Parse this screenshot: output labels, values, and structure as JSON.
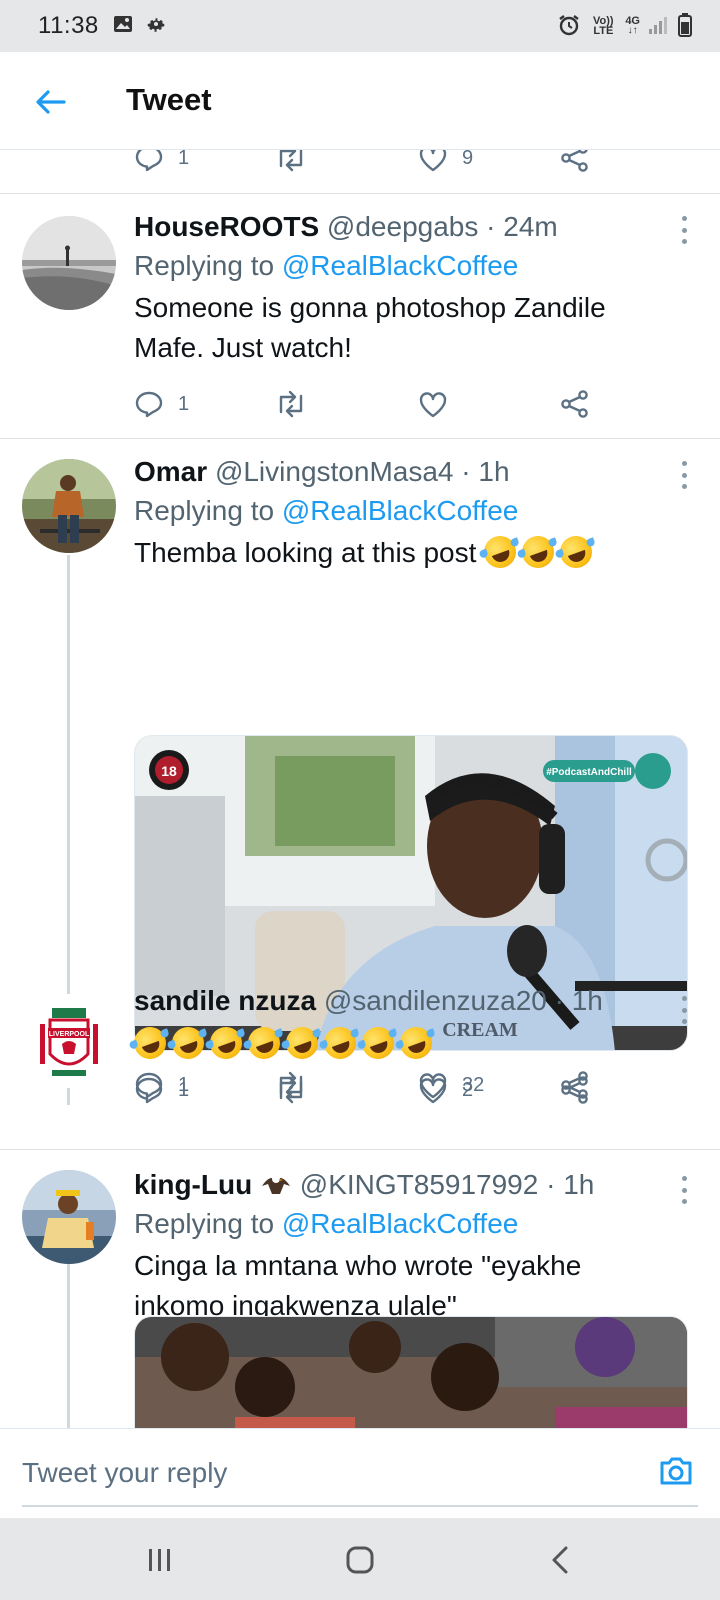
{
  "status_bar": {
    "time": "11:38",
    "network_top": "Vo)) LTE",
    "network_type": "4G",
    "icons": [
      "image-icon",
      "gear-icon",
      "alarm-icon",
      "signal-icon",
      "battery-icon"
    ]
  },
  "header": {
    "title": "Tweet"
  },
  "top_actions": {
    "replies": "1",
    "likes": "9"
  },
  "tweets": [
    {
      "name": "HouseROOTS",
      "handle": "@deepgabs",
      "time": "· 24m",
      "replying_prefix": "Replying to",
      "replying_to": "@RealBlackCoffee",
      "text_line1": "Someone is gonna photoshop Zandile",
      "text_line2": "Mafe. Just watch!",
      "replies": "1",
      "likes": ""
    },
    {
      "name": "Omar",
      "handle": "@LivingstonMasa4",
      "time": "· 1h",
      "replying_prefix": "Replying to",
      "replying_to": "@RealBlackCoffee",
      "text": "Themba looking at this post",
      "emoji_count": 3,
      "media_badge": "#PodcastAndChill",
      "media_logo": "18",
      "media_shirt": "CREAM",
      "replies": "1",
      "likes": "32"
    },
    {
      "name": "sandile nzuza",
      "handle": "@sandilenzuza20",
      "time": "· 1h",
      "emoji_count": 8,
      "club_badge": "LIVERPOOL",
      "replies": "1",
      "likes": "2"
    },
    {
      "name": "king-Luu",
      "handle": "@KINGT85917992",
      "time": "· 1h",
      "replying_prefix": "Replying to",
      "replying_to": "@RealBlackCoffee",
      "text_line1": "Cinga la mntana who wrote \"eyakhe",
      "text_line2": "inkomo ingakwenza ulale\""
    }
  ],
  "composer": {
    "placeholder": "Tweet your reply"
  },
  "colors": {
    "accent": "#1d9bf0",
    "text": "#0f1419",
    "secondary": "#536471"
  }
}
